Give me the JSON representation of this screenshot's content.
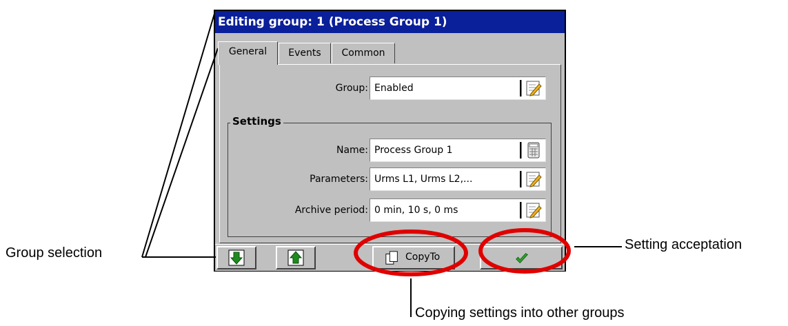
{
  "window": {
    "title": "Editing group: 1 (Process Group 1)"
  },
  "tabs": [
    {
      "label": "General",
      "active": true
    },
    {
      "label": "Events",
      "active": false
    },
    {
      "label": "Common",
      "active": false
    }
  ],
  "group_field": {
    "label": "Group:",
    "value": "Enabled",
    "icon": "edit-pencil-icon"
  },
  "settings": {
    "title": "Settings",
    "name": {
      "label": "Name:",
      "value": "Process Group 1",
      "icon": "keyboard-icon"
    },
    "parameters": {
      "label": "Parameters:",
      "value": "Urms L1, Urms L2,...",
      "icon": "edit-pencil-icon"
    },
    "archive_period": {
      "label": "Archive period:",
      "value": "0 min, 10 s, 0 ms",
      "icon": "edit-pencil-icon"
    }
  },
  "bottom_bar": {
    "down_button_icon": "arrow-down-icon",
    "up_button_icon": "arrow-up-icon",
    "copy_label": "CopyTo",
    "ok_icon": "checkmark-icon"
  },
  "annotations": {
    "group_selection": "Group selection",
    "setting_acceptation": "Setting acceptation",
    "copying_settings": "Copying settings into other groups"
  },
  "colors": {
    "title_bar": "#0a1f9a",
    "window_bg": "#c0c0c0",
    "highlight_circle": "#e00000",
    "arrow_green": "#1f8a1f",
    "check_green": "#2aa52a"
  }
}
